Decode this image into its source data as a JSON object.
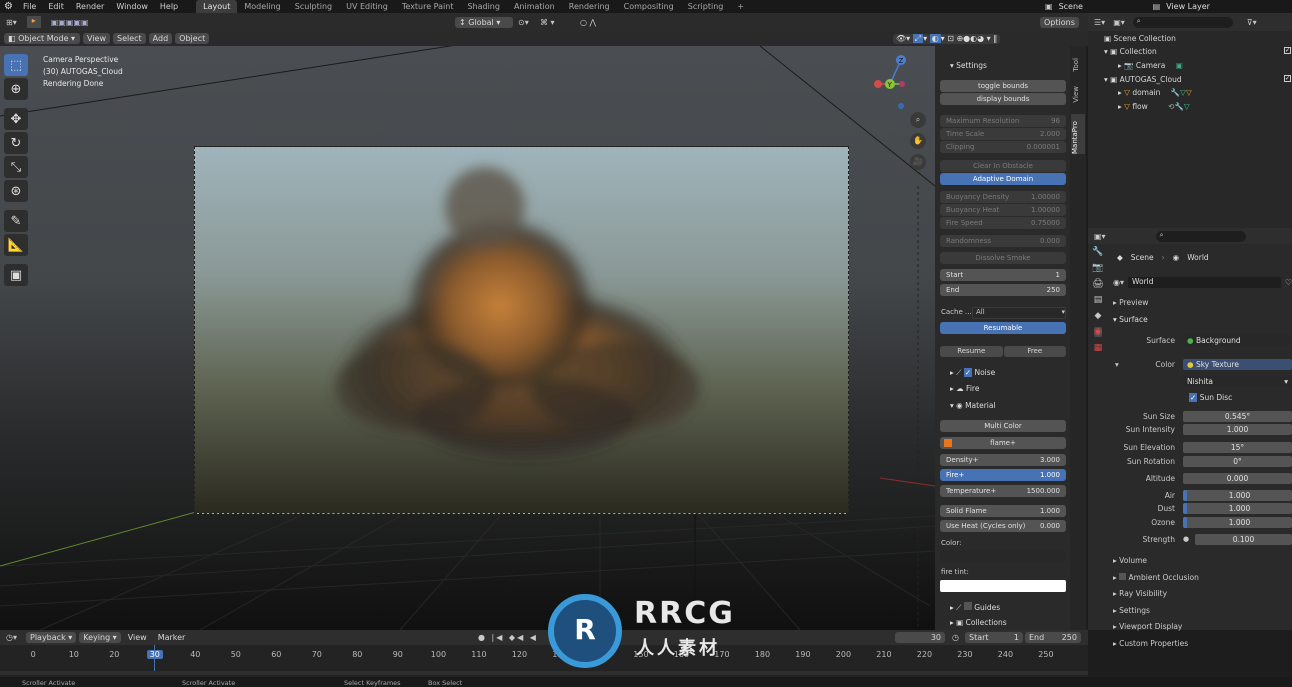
{
  "menubar": {
    "items": [
      "File",
      "Edit",
      "Render",
      "Window",
      "Help"
    ]
  },
  "workspaces": [
    "Layout",
    "Modeling",
    "Sculpting",
    "UV Editing",
    "Texture Paint",
    "Shading",
    "Animation",
    "Rendering",
    "Compositing",
    "Scripting"
  ],
  "scene": {
    "name": "Scene",
    "view_layer": "View Layer"
  },
  "viewport_header": {
    "mode": "Object Mode",
    "menus": [
      "View",
      "Select",
      "Add",
      "Object"
    ],
    "transform": "Global",
    "options": "Options"
  },
  "viewport_info": {
    "line1": "Camera Perspective",
    "line2": "(30) AUTOGAS_Cloud",
    "line3": "Rendering Done"
  },
  "side_tabs": [
    "Tool",
    "View",
    "MantaPro"
  ],
  "npanel": {
    "header": "Settings",
    "toggle_bounds": "toggle bounds",
    "display_bounds": "display bounds",
    "max_res": {
      "label": "Maximum Resolution",
      "value": "96"
    },
    "time_scale": {
      "label": "Time Scale",
      "value": "2.000"
    },
    "clipping": {
      "label": "Clipping",
      "value": "0.000001"
    },
    "clear_obstacle": "Clear In Obstacle",
    "adaptive_domain": "Adaptive Domain",
    "buoy_density": {
      "label": "Buoyancy Density",
      "value": "1.00000"
    },
    "buoy_heat": {
      "label": "Buoyancy Heat",
      "value": "1.00000"
    },
    "fire_speed": {
      "label": "Fire Speed",
      "value": "0.75000"
    },
    "randomness": {
      "label": "Randomness",
      "value": "0.000"
    },
    "dissolve_smoke": "Dissolve Smoke",
    "start": {
      "label": "Start",
      "value": "1"
    },
    "end": {
      "label": "End",
      "value": "250"
    },
    "cache_label": "Cache ...",
    "cache_value": "All",
    "resumable": "Resumable",
    "resume": "Resume",
    "free": "Free",
    "noise": "Noise",
    "fire": "Fire",
    "material": "Material",
    "multi_color": "Multi Color",
    "flame": "flame+",
    "density": {
      "label": "Density+",
      "value": "3.000"
    },
    "fire_plus": {
      "label": "Fire+",
      "value": "1.000"
    },
    "temperature": {
      "label": "Temperature+",
      "value": "1500.000"
    },
    "solid_flame": {
      "label": "Solid Flame",
      "value": "1.000"
    },
    "use_heat": {
      "label": "Use Heat (Cycles only)",
      "value": "0.000"
    },
    "color_label": "Color:",
    "fire_tint_label": "fire tint:",
    "guides": "Guides",
    "collections": "Collections"
  },
  "outliner": {
    "root": "Scene Collection",
    "items": [
      {
        "name": "Collection",
        "depth": 1
      },
      {
        "name": "Camera",
        "depth": 2
      },
      {
        "name": "AUTOGAS_Cloud",
        "depth": 1
      },
      {
        "name": "domain",
        "depth": 2
      },
      {
        "name": "flow",
        "depth": 2
      }
    ]
  },
  "properties": {
    "breadcrumb_scene": "Scene",
    "breadcrumb_world": "World",
    "world_name": "World",
    "preview": "Preview",
    "surface_section": "Surface",
    "surface": {
      "label": "Surface",
      "value": "Background"
    },
    "color": {
      "label": "Color",
      "value": "Sky Texture"
    },
    "sky_type": "Nishita",
    "sun_disc": "Sun Disc",
    "sun_size": {
      "label": "Sun Size",
      "value": "0.545°"
    },
    "sun_intensity": {
      "label": "Sun Intensity",
      "value": "1.000"
    },
    "sun_elevation": {
      "label": "Sun Elevation",
      "value": "15°"
    },
    "sun_rotation": {
      "label": "Sun Rotation",
      "value": "0°"
    },
    "altitude": {
      "label": "Altitude",
      "value": "0.000"
    },
    "air": {
      "label": "Air",
      "value": "1.000"
    },
    "dust": {
      "label": "Dust",
      "value": "1.000"
    },
    "ozone": {
      "label": "Ozone",
      "value": "1.000"
    },
    "strength": {
      "label": "Strength",
      "value": "0.100"
    },
    "sections": [
      "Volume",
      "Ambient Occlusion",
      "Ray Visibility",
      "Settings",
      "Viewport Display",
      "Custom Properties"
    ]
  },
  "timeline": {
    "menus": [
      "Playback",
      "Keying",
      "View",
      "Marker"
    ],
    "current_frame": "30",
    "start_label": "Start",
    "start": "1",
    "end_label": "End",
    "end": "250",
    "ticks": [
      "0",
      "10",
      "20",
      "30",
      "40",
      "50",
      "60",
      "70",
      "80",
      "90",
      "100",
      "110",
      "120",
      "130",
      "140",
      "150",
      "160",
      "170",
      "180",
      "190",
      "200",
      "210",
      "220",
      "230",
      "240",
      "250"
    ]
  },
  "statusbar": {
    "items": [
      "Scroller Activate",
      "Scroller Activate",
      "Select Keyframes",
      "Box Select"
    ]
  },
  "watermark": {
    "brand": "RRCG",
    "sub": "人人素材"
  },
  "colors": {
    "accent": "#4772b3",
    "fire": "#e8761f"
  }
}
